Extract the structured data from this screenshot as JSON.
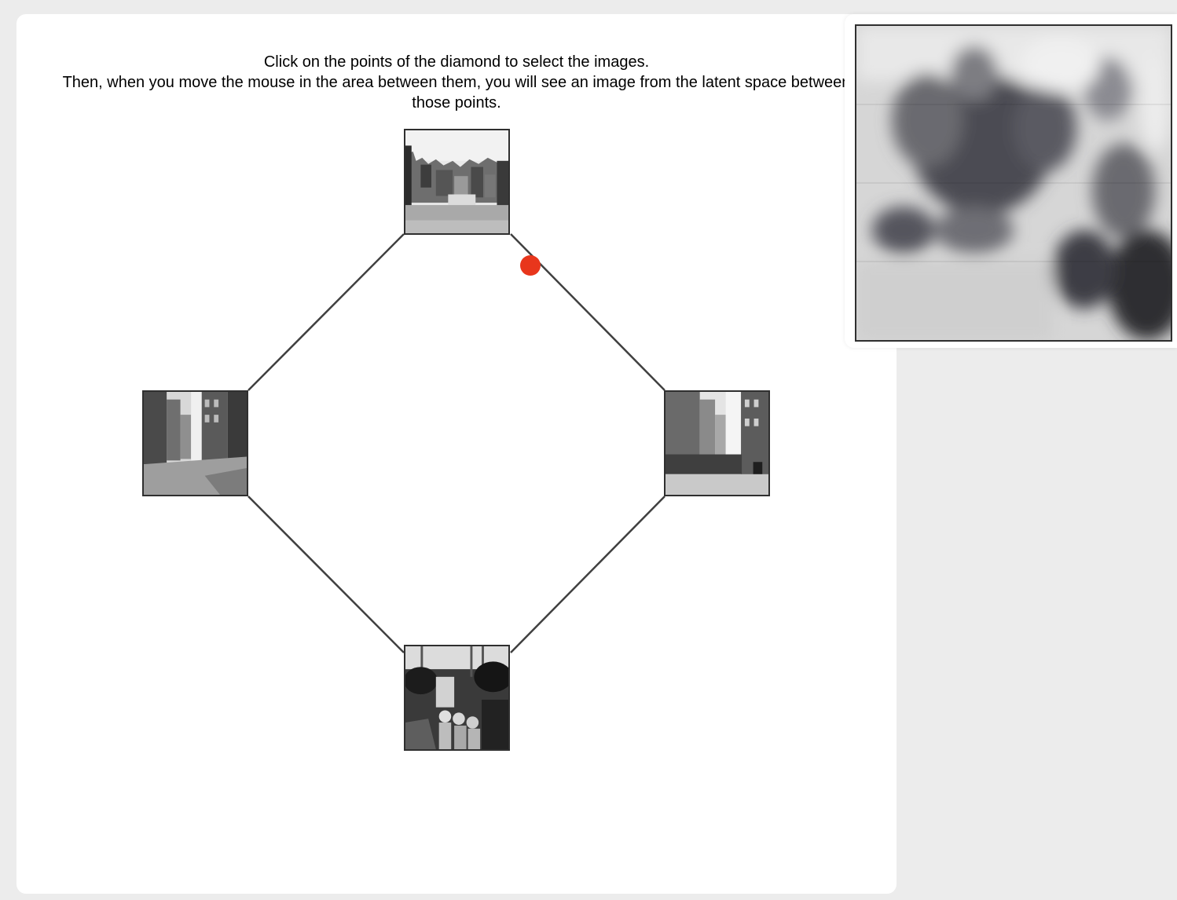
{
  "instructions": {
    "line1": "Click on the points of the diamond to select the images.",
    "line2": "Then, when you move the mouse in the area between them, you will see an image from the latent space between those points."
  },
  "colors": {
    "background": "#ececec",
    "card": "#ffffff",
    "edge": "#404040",
    "cursor_dot": "#e8361c"
  },
  "diamond": {
    "nodes": [
      {
        "position": "top",
        "thumbnail": "black-and-white photo of old town buildings"
      },
      {
        "position": "left",
        "thumbnail": "black-and-white photo of a city street corner"
      },
      {
        "position": "right",
        "thumbnail": "black-and-white photo of a crowded street with storefronts"
      },
      {
        "position": "bottom",
        "thumbnail": "black-and-white photo of a crowd of people"
      }
    ]
  },
  "preview": {
    "content": "blurry interpolated latent-space image"
  }
}
